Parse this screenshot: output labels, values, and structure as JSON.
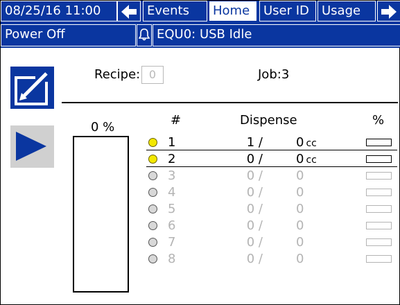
{
  "header": {
    "datetime": "08/25/16 11:00",
    "tabs": [
      {
        "label": "Events",
        "active": false
      },
      {
        "label": "Home",
        "active": true
      },
      {
        "label": "User ID",
        "active": false
      },
      {
        "label": "Usage",
        "active": false
      }
    ],
    "left_arrow_icon": "left-arrow-icon",
    "right_arrow_icon": "right-arrow-icon"
  },
  "status_bar": {
    "state": "Power Off",
    "alarm_icon": "bell-icon",
    "message": "EQU0: USB Idle"
  },
  "main": {
    "recipe_label": "Recipe:",
    "recipe_value": "0",
    "job_label": "Job:",
    "job_value": "3",
    "edit_icon": "edit-icon",
    "run_icon": "play-icon",
    "overall_percent_label": "0 %",
    "overall_percent": 0,
    "columns": {
      "num": "#",
      "dispense": "Dispense",
      "percent": "%"
    },
    "rows": [
      {
        "num": "1",
        "target": "1 /",
        "dispensed": "0",
        "unit": "cc",
        "active": true,
        "percent": 0
      },
      {
        "num": "2",
        "target": "0 /",
        "dispensed": "0",
        "unit": "cc",
        "active": true,
        "percent": 0
      },
      {
        "num": "3",
        "target": "0 /",
        "dispensed": "0",
        "unit": "",
        "active": false,
        "percent": 0
      },
      {
        "num": "4",
        "target": "0 /",
        "dispensed": "0",
        "unit": "",
        "active": false,
        "percent": 0
      },
      {
        "num": "5",
        "target": "0 /",
        "dispensed": "0",
        "unit": "",
        "active": false,
        "percent": 0
      },
      {
        "num": "6",
        "target": "0 /",
        "dispensed": "0",
        "unit": "",
        "active": false,
        "percent": 0
      },
      {
        "num": "7",
        "target": "0 /",
        "dispensed": "0",
        "unit": "",
        "active": false,
        "percent": 0
      },
      {
        "num": "8",
        "target": "0 /",
        "dispensed": "0",
        "unit": "",
        "active": false,
        "percent": 0
      }
    ]
  },
  "colors": {
    "accent_blue": "#0a36a0",
    "active_dot": "#f3e800",
    "inactive_text": "#b4b4b4"
  }
}
